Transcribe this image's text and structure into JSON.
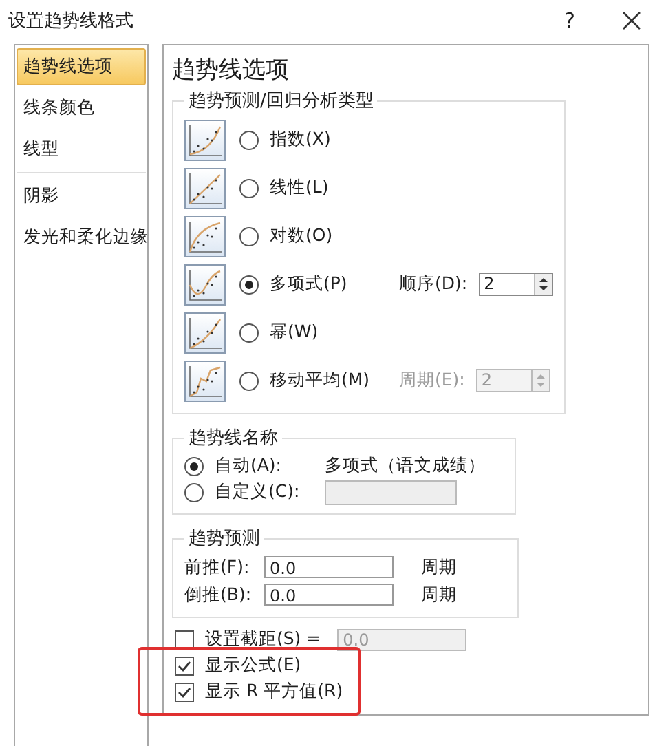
{
  "window": {
    "title": "设置趋势线格式",
    "help": "?"
  },
  "sidebar": {
    "groups": [
      {
        "items": [
          {
            "label": "趋势线选项",
            "selected": true
          },
          {
            "label": "线条颜色",
            "selected": false
          },
          {
            "label": "线型",
            "selected": false
          }
        ]
      },
      {
        "items": [
          {
            "label": "阴影",
            "selected": false
          },
          {
            "label": "发光和柔化边缘",
            "selected": false
          }
        ]
      }
    ]
  },
  "panel": {
    "title": "趋势线选项",
    "regression": {
      "title": "趋势预测/回归分析类型",
      "types": [
        {
          "kind": "exponential",
          "label": "指数(X)",
          "selected": false
        },
        {
          "kind": "linear",
          "label": "线性(L)",
          "selected": false
        },
        {
          "kind": "log",
          "label": "对数(O)",
          "selected": false
        },
        {
          "kind": "polynomial",
          "label": "多项式(P)",
          "selected": true,
          "param": {
            "label": "顺序(D):",
            "value": "2",
            "disabled": false
          }
        },
        {
          "kind": "power",
          "label": "幂(W)",
          "selected": false
        },
        {
          "kind": "moving",
          "label": "移动平均(M)",
          "selected": false,
          "param": {
            "label": "周期(E):",
            "value": "2",
            "disabled": true
          }
        }
      ]
    },
    "name": {
      "title": "趋势线名称",
      "options": [
        {
          "label": "自动(A):",
          "selected": true,
          "kind": "text",
          "value": "多项式（语文成绩）"
        },
        {
          "label": "自定义(C):",
          "selected": false,
          "kind": "field"
        }
      ]
    },
    "forecast": {
      "title": "趋势预测",
      "rows": [
        {
          "label": "前推(F):",
          "value": "0.0",
          "unit": "周期"
        },
        {
          "label": "倒推(B):",
          "value": "0.0",
          "unit": "周期"
        }
      ]
    },
    "intercept": {
      "label": "设置截距(S) =",
      "checked": false,
      "value": "0.0"
    },
    "checks": [
      {
        "label": "显示公式(E)",
        "checked": true
      },
      {
        "label": "显示 R 平方值(R)",
        "checked": true
      }
    ]
  }
}
